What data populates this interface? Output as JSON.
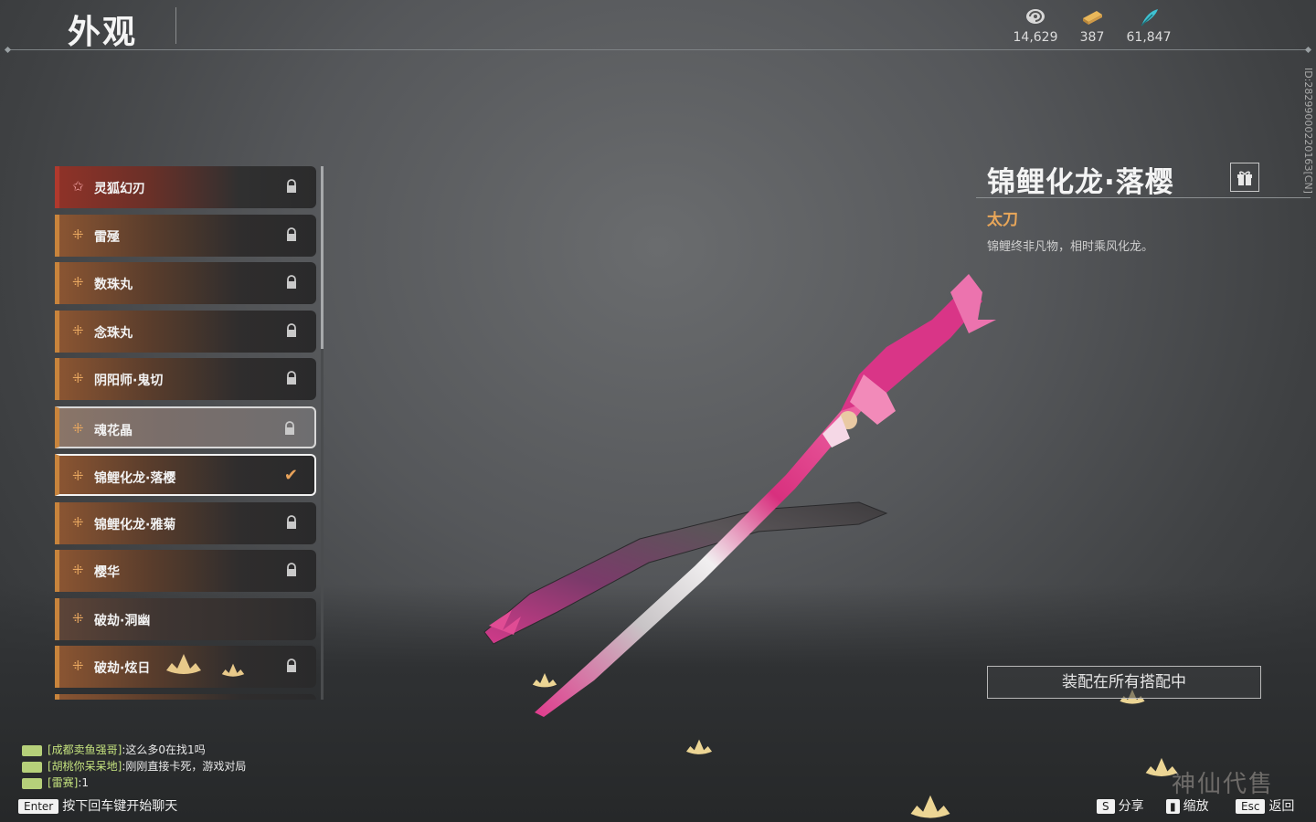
{
  "header": {
    "title": "外观"
  },
  "currencies": [
    {
      "icon": "spiral-coin-icon",
      "value": "14,629"
    },
    {
      "icon": "gold-ingot-icon",
      "value": "387"
    },
    {
      "icon": "jade-feather-icon",
      "value": "61,847"
    }
  ],
  "player_id": "ID:2829900022016З[CN]",
  "skin_list": {
    "items": [
      {
        "label": "灵狐幻刃",
        "state": "locked",
        "icon": "star-icon"
      },
      {
        "label": "雷殛",
        "state": "locked",
        "icon": "clover-icon"
      },
      {
        "label": "数珠丸",
        "state": "locked",
        "icon": "clover-icon"
      },
      {
        "label": "念珠丸",
        "state": "locked",
        "icon": "clover-icon"
      },
      {
        "label": "阴阳师·鬼切",
        "state": "locked",
        "icon": "clover-icon"
      },
      {
        "label": "魂花晶",
        "state": "locked",
        "icon": "clover-icon"
      },
      {
        "label": "锦鲤化龙·落樱",
        "state": "equipped",
        "icon": "clover-icon"
      },
      {
        "label": "锦鲤化龙·雅菊",
        "state": "locked",
        "icon": "clover-icon"
      },
      {
        "label": "樱华",
        "state": "locked",
        "icon": "clover-icon"
      },
      {
        "label": "破劫·洞幽",
        "state": "none",
        "icon": "clover-icon"
      },
      {
        "label": "破劫·炫日",
        "state": "locked",
        "icon": "clover-icon"
      }
    ]
  },
  "detail": {
    "name": "锦鲤化龙·落樱",
    "type": "太刀",
    "description": "锦鲤终非凡物，相时乘风化龙。",
    "equip_all_label": "装配在所有搭配中"
  },
  "chat": {
    "messages": [
      {
        "name": "[成都卖鱼强哥]",
        "text": ":这么多0在找1吗"
      },
      {
        "name": "[胡桃你呆呆地]",
        "text": ":刚刚直接卡死，游戏对局"
      },
      {
        "name": "[雷赛]",
        "text": ":1"
      }
    ],
    "hint_key": "Enter",
    "hint_text": "按下回车键开始聊天"
  },
  "bottom_hints": [
    {
      "key": "S",
      "label": "分享"
    },
    {
      "key": "",
      "label": "缩放"
    },
    {
      "key": "Esc",
      "label": "返回"
    }
  ],
  "watermark": "神仙代售",
  "colors": {
    "accent": "#e8a659",
    "locked_item": "#c8843c",
    "featured_item": "#b0392d",
    "chat_name": "#c4e27e"
  }
}
